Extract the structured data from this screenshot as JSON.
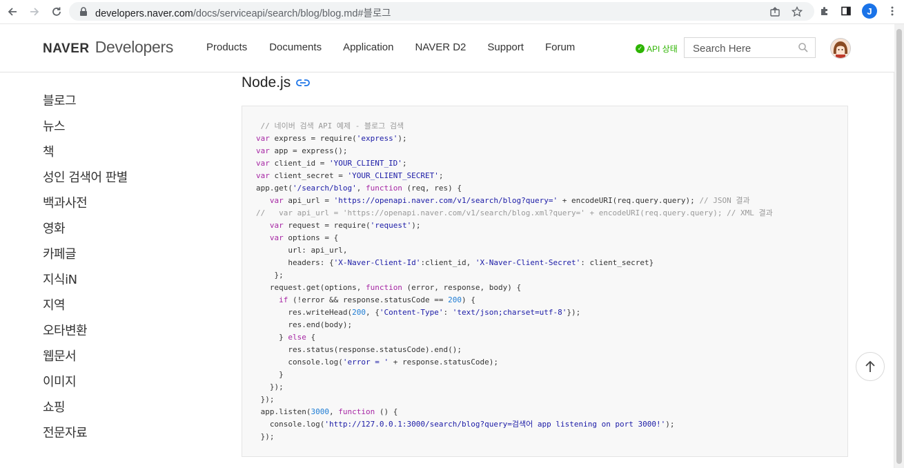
{
  "browser": {
    "url_host": "developers.naver.com",
    "url_path": "/docs/serviceapi/search/blog/blog.md#블로그",
    "profile_initial": "J"
  },
  "header": {
    "logo_brand": "NAVER",
    "logo_product": "Developers",
    "nav": [
      "Products",
      "Documents",
      "Application",
      "NAVER D2",
      "Support",
      "Forum"
    ],
    "api_status": "API 상태",
    "search_placeholder": "Search Here"
  },
  "sidebar": {
    "items": [
      "블로그",
      "뉴스",
      "책",
      "성인 검색어 판별",
      "백과사전",
      "영화",
      "카페글",
      "지식iN",
      "지역",
      "오타변환",
      "웹문서",
      "이미지",
      "쇼핑",
      "전문자료"
    ]
  },
  "main": {
    "section_title": "Node.js",
    "code_lines": [
      " // 네이버 검색 API 예제 - 블로그 검색",
      "var express = require('express');",
      "var app = express();",
      "var client_id = 'YOUR_CLIENT_ID';",
      "var client_secret = 'YOUR_CLIENT_SECRET';",
      "app.get('/search/blog', function (req, res) {",
      "   var api_url = 'https://openapi.naver.com/v1/search/blog?query=' + encodeURI(req.query.query); // JSON 결과",
      "//   var api_url = 'https://openapi.naver.com/v1/search/blog.xml?query=' + encodeURI(req.query.query); // XML 결과",
      "   var request = require('request');",
      "   var options = {",
      "       url: api_url,",
      "       headers: {'X-Naver-Client-Id':client_id, 'X-Naver-Client-Secret': client_secret}",
      "    };",
      "   request.get(options, function (error, response, body) {",
      "     if (!error && response.statusCode == 200) {",
      "       res.writeHead(200, {'Content-Type': 'text/json;charset=utf-8'});",
      "       res.end(body);",
      "     } else {",
      "       res.status(response.statusCode).end();",
      "       console.log('error = ' + response.statusCode);",
      "     }",
      "   });",
      " });",
      " app.listen(3000, function () {",
      "   console.log('http://127.0.0.1:3000/search/blog?query=검색어 app listening on port 3000!');",
      " });"
    ]
  },
  "colors": {
    "brand_green": "#2db400",
    "code_keyword": "#a626a4",
    "code_string": "#1a1aa6",
    "code_number": "#1c7bd4",
    "code_comment": "#999999"
  }
}
